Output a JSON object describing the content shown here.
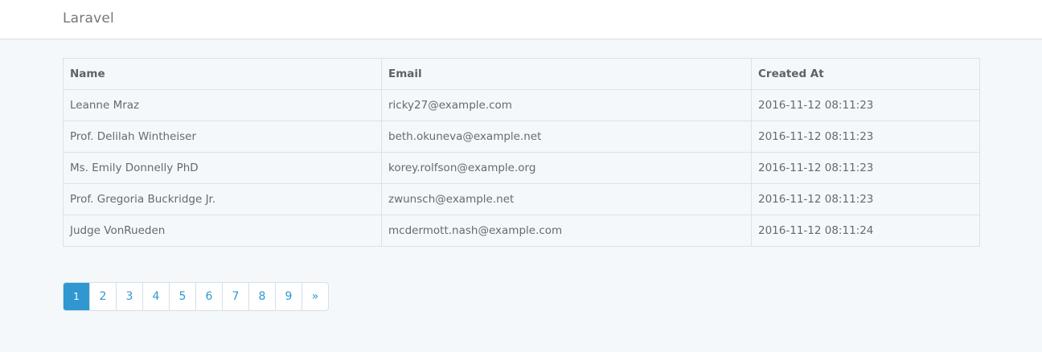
{
  "navbar": {
    "brand": "Laravel"
  },
  "table": {
    "headers": {
      "name": "Name",
      "email": "Email",
      "created_at": "Created At"
    },
    "rows": [
      {
        "name": "Leanne Mraz",
        "email": "ricky27@example.com",
        "created_at": "2016-11-12 08:11:23"
      },
      {
        "name": "Prof. Delilah Wintheiser",
        "email": "beth.okuneva@example.net",
        "created_at": "2016-11-12 08:11:23"
      },
      {
        "name": "Ms. Emily Donnelly PhD",
        "email": "korey.rolfson@example.org",
        "created_at": "2016-11-12 08:11:23"
      },
      {
        "name": "Prof. Gregoria Buckridge Jr.",
        "email": "zwunsch@example.net",
        "created_at": "2016-11-12 08:11:23"
      },
      {
        "name": "Judge VonRueden",
        "email": "mcdermott.nash@example.com",
        "created_at": "2016-11-12 08:11:24"
      }
    ]
  },
  "pagination": {
    "pages": [
      "1",
      "2",
      "3",
      "4",
      "5",
      "6",
      "7",
      "8",
      "9"
    ],
    "active": "1",
    "next_label": "»"
  },
  "colors": {
    "accent": "#3097d1",
    "background": "#f5f8fa",
    "border": "#d3e0e9",
    "text": "#636b6f"
  }
}
